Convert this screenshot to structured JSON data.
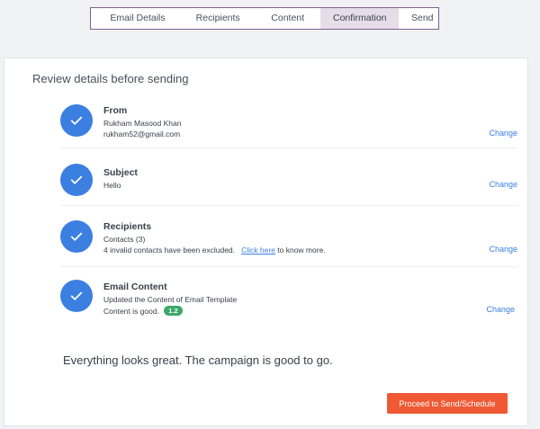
{
  "stepper": {
    "steps": [
      {
        "label": "Email Details",
        "active": false
      },
      {
        "label": "Recipients",
        "active": false
      },
      {
        "label": "Content",
        "active": false
      },
      {
        "label": "Confirmation",
        "active": true
      },
      {
        "label": "Send",
        "active": false
      }
    ]
  },
  "review": {
    "title": "Review details before sending",
    "sections": [
      {
        "title": "From",
        "lines": [
          "Rukham Masood Khan",
          "rukham52@gmail.com"
        ],
        "change_label": "Change"
      },
      {
        "title": "Subject",
        "lines": [
          "Hello"
        ],
        "change_label": "Change"
      },
      {
        "title": "Recipients",
        "lines": [
          "Contacts (3)"
        ],
        "excluded_text": "4 invalid contacts have been excluded.",
        "link_text": "Click here",
        "link_suffix": "to know more.",
        "change_label": "Change"
      },
      {
        "title": "Email Content",
        "lines": [
          "Updated the Content of Email Template"
        ],
        "status_text": "Content is good.",
        "badge": "1.2",
        "change_label": "Change"
      }
    ],
    "final_message": "Everything looks great. The campaign is good to go.",
    "proceed_label": "Proceed to Send/Schedule"
  },
  "colors": {
    "accent": "#3b7fe0",
    "primary_button": "#ef5a34",
    "badge": "#3aa86b",
    "active_step": "#e6dde9"
  },
  "icons": {
    "section_status": "check-circle-icon"
  }
}
